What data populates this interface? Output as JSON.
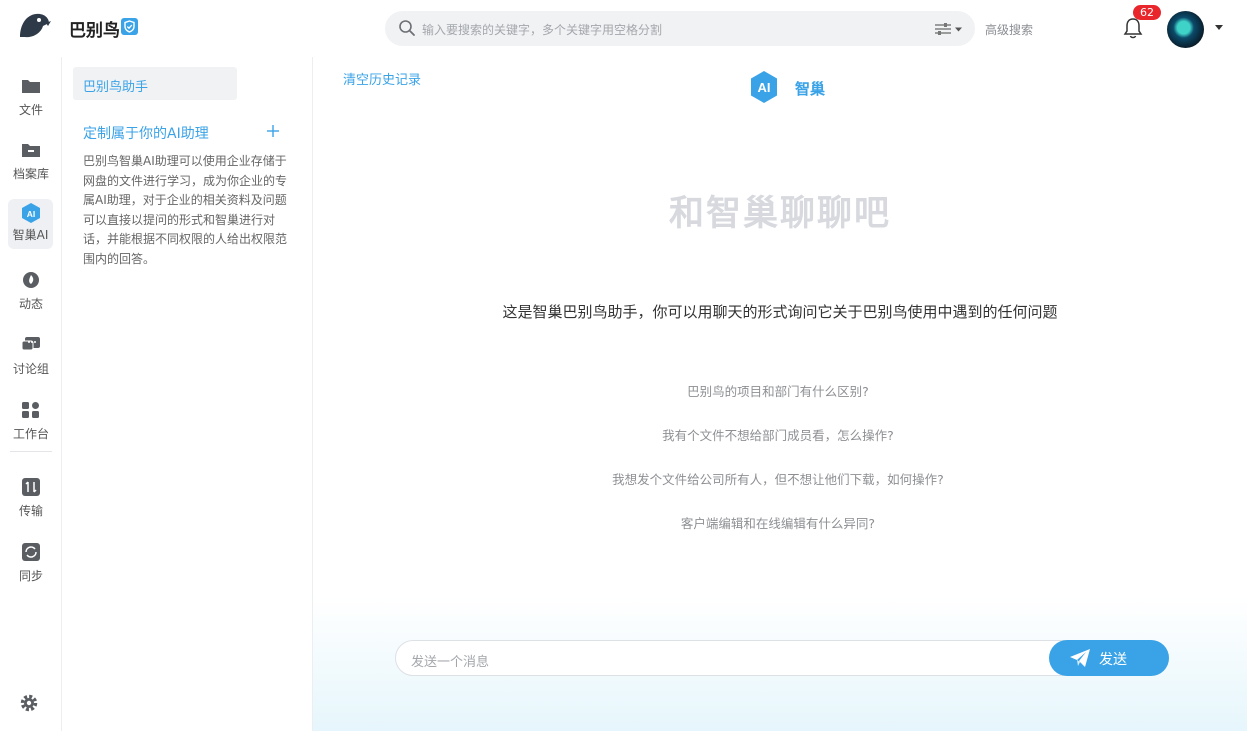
{
  "header": {
    "brand": "巴别鸟",
    "search_placeholder": "输入要搜索的关键字，多个关键字用空格分割",
    "advanced_search": "高级搜索",
    "notification_count": "62"
  },
  "rail": {
    "items": [
      {
        "label": "文件",
        "icon": "folder-icon"
      },
      {
        "label": "档案库",
        "icon": "archive-icon"
      },
      {
        "label": "智巢AI",
        "icon": "ai-icon"
      },
      {
        "label": "动态",
        "icon": "flame-icon"
      },
      {
        "label": "讨论组",
        "icon": "chat-icon"
      },
      {
        "label": "工作台",
        "icon": "grid-icon"
      },
      {
        "label": "传输",
        "icon": "transfer-icon"
      },
      {
        "label": "同步",
        "icon": "sync-icon"
      }
    ]
  },
  "panel": {
    "assistant_tab": "巴别鸟助手",
    "custom_title": "定制属于你的AI助理",
    "custom_desc": "巴别鸟智巢AI助理可以使用企业存储于网盘的文件进行学习，成为你企业的专属AI助理，对于企业的相关资料及问题可以直接以提问的形式和智巢进行对话，并能根据不同权限的人给出权限范围内的回答。"
  },
  "main": {
    "clear_history": "清空历史记录",
    "ai_badge": "AI",
    "ai_name": "智巢",
    "hero": "和智巢聊聊吧",
    "intro": "这是智巢巴别鸟助手，你可以用聊天的形式询问它关于巴别鸟使用中遇到的任何问题",
    "suggestions": [
      "巴别鸟的项目和部门有什么区别?",
      "我有个文件不想给部门成员看，怎么操作?",
      "我想发个文件给公司所有人，但不想让他们下载，如何操作?",
      "客户端编辑和在线编辑有什么异同?"
    ],
    "input_placeholder": "发送一个消息",
    "send_label": "发送"
  },
  "colors": {
    "accent": "#3aa3e8",
    "badge": "#e8262c",
    "hero_text": "#d7d9de"
  }
}
